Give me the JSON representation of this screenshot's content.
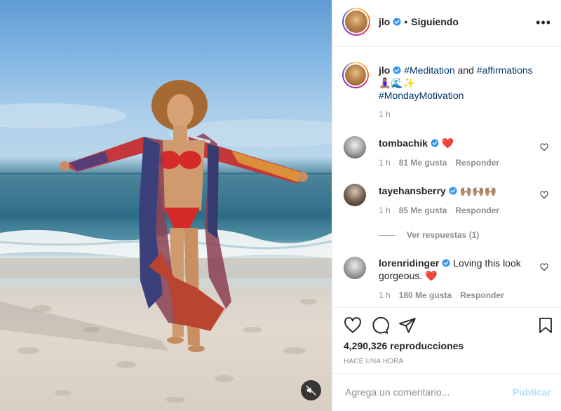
{
  "post": {
    "author": "jlo",
    "follow_status": "Siguiendo",
    "more_glyph": "•••",
    "dot": "•"
  },
  "caption": {
    "username": "jlo",
    "text_hash1": "#Meditation",
    "text_and": " and ",
    "text_hash2": "#affirmations",
    "emoji_line": "🧘🏽‍♀️🌊✨",
    "text_hash3": "#MondayMotivation",
    "time": "1 h"
  },
  "comments": [
    {
      "username": "tombachik",
      "text": "❤️",
      "time": "1 h",
      "likes": "81 Me gusta",
      "reply": "Responder"
    },
    {
      "username": "tayehansberry",
      "text": "🙌🏽🙌🏽🙌🏽",
      "time": "1 h",
      "likes": "85 Me gusta",
      "reply": "Responder",
      "view_replies": "Ver respuestas (1)"
    },
    {
      "username": "lorenridinger",
      "text": "Loving this look gorgeous. ❤️",
      "time": "1 h",
      "likes": "180 Me gusta",
      "reply": "Responder"
    }
  ],
  "stats": {
    "views": "4,290,326 reproducciones",
    "posted": "HACE UNA HORA"
  },
  "composer": {
    "placeholder": "Agrega un comentario...",
    "publish": "Publicar"
  },
  "icons": {
    "verified": "verified-badge-icon",
    "like": "heart-icon",
    "comment": "comment-bubble-icon",
    "share": "paper-plane-icon",
    "save": "bookmark-icon",
    "mute": "speaker-muted-icon"
  },
  "colors": {
    "verified": "#3897f0",
    "link": "#00376b",
    "publish_disabled": "#b2dffc",
    "muted_text": "#8e8e8e",
    "border": "#efefef"
  }
}
